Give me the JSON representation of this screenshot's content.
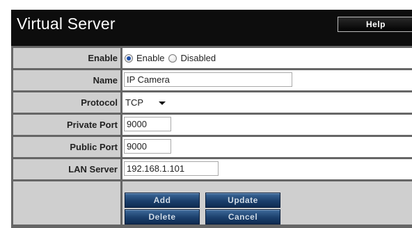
{
  "header": {
    "title": "Virtual Server",
    "help_label": "Help"
  },
  "form": {
    "enable": {
      "label": "Enable",
      "options": [
        {
          "label": "Enable",
          "checked": true
        },
        {
          "label": "Disabled",
          "checked": false
        }
      ]
    },
    "name": {
      "label": "Name",
      "value": "IP Camera"
    },
    "protocol": {
      "label": "Protocol",
      "value": "TCP"
    },
    "private_port": {
      "label": "Private Port",
      "value": "9000"
    },
    "public_port": {
      "label": "Public Port",
      "value": "9000"
    },
    "lan_server": {
      "label": "LAN Server",
      "value": "192.168.1.101"
    }
  },
  "actions": {
    "add_label": "Add",
    "update_label": "Update",
    "delete_label": "Delete",
    "cancel_label": "Cancel"
  },
  "colors": {
    "header_bg": "#0d0d0d",
    "label_bg": "#cfcfcf",
    "border": "#666666",
    "button_blue": "#1b3f6c"
  }
}
